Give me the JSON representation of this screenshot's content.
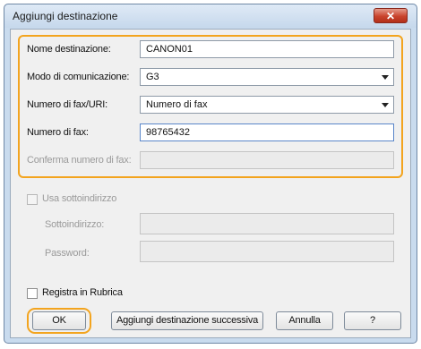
{
  "dialog": {
    "title": "Aggiungi destinazione",
    "close_label": "✕"
  },
  "form": {
    "name_label": "Nome destinazione:",
    "name_value": "CANON01",
    "mode_label": "Modo di comunicazione:",
    "mode_value": "G3",
    "type_label": "Numero di fax/URI:",
    "type_value": "Numero di fax",
    "fax_label": "Numero di fax:",
    "fax_value": "98765432",
    "confirm_label": "Conferma numero di fax:",
    "confirm_value": ""
  },
  "subaddress": {
    "checkbox_label": "Usa sottoindirizzo",
    "sub_label": "Sottoindirizzo:",
    "password_label": "Password:"
  },
  "register": {
    "checkbox_label": "Registra in Rubrica"
  },
  "buttons": {
    "ok": "OK",
    "add_next": "Aggiungi destinazione successiva",
    "cancel": "Annulla",
    "help": "?"
  },
  "colors": {
    "highlight": "#f3a41e",
    "close": "#c9432c"
  }
}
